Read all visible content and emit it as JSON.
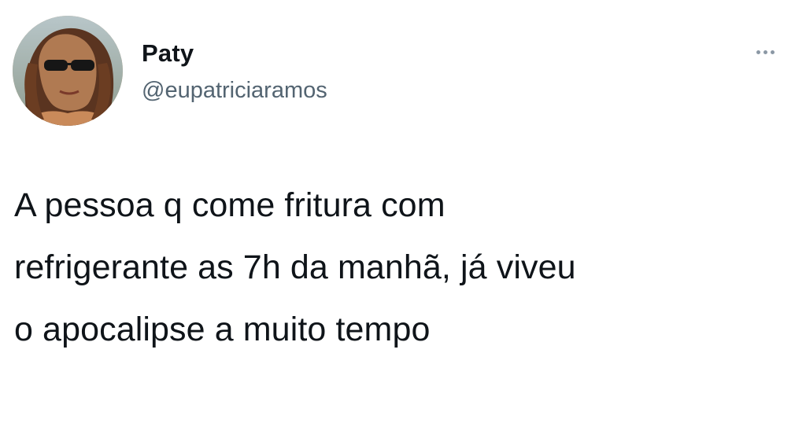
{
  "tweet": {
    "author": {
      "display_name": "Paty",
      "handle": "@eupatriciaramos",
      "avatar_icon": "profile-photo"
    },
    "more_icon": "more-options-icon",
    "text_lines": [
      "A pessoa q come fritura com",
      "refrigerante as 7h da manhã, já viveu",
      "o apocalipse a muito tempo"
    ]
  },
  "colors": {
    "background": "#ffffff",
    "text_primary": "#0f1419",
    "text_secondary": "#536471"
  }
}
